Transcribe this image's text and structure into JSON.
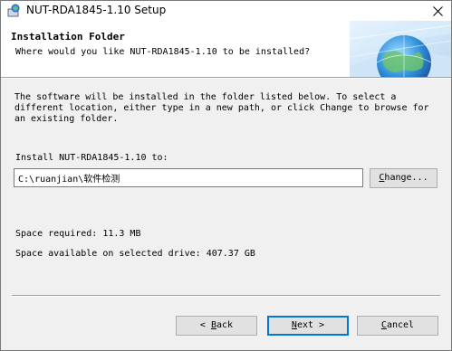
{
  "window": {
    "title": "NUT-RDA1845-1.10 Setup",
    "close_glyph": "✕"
  },
  "header": {
    "title": "Installation Folder",
    "subtitle": "Where would you like NUT-RDA1845-1.10 to be installed?"
  },
  "body": {
    "description": "The software will be installed in the folder listed below. To select a\ndifferent location, either type in a new path, or click Change to browse for\nan existing folder.",
    "install_label": "Install NUT-RDA1845-1.10 to:",
    "path_value": "C:\\ruanjian\\软件检测",
    "change_button": {
      "accel": "C",
      "rest": "hange..."
    },
    "space_required": "Space required: 11.3 MB",
    "space_available": "Space available on selected drive: 407.37 GB"
  },
  "footer": {
    "back_button": {
      "prefix": "< ",
      "accel": "B",
      "rest": "ack"
    },
    "next_button": {
      "accel": "N",
      "rest": "ext >"
    },
    "cancel_button": {
      "accel": "C",
      "rest": "ancel"
    }
  },
  "colors": {
    "window_bg": "#f0f0f0",
    "header_bg": "#ffffff",
    "button_bg": "#e1e1e1",
    "default_button_border": "#0078d7"
  },
  "icons": {
    "app": "setup-globe-icon",
    "close": "close-icon",
    "banner": "globe-banner-graphic"
  }
}
